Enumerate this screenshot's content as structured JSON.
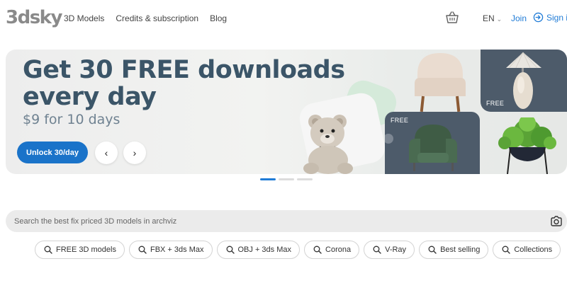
{
  "header": {
    "logo": "3dsky",
    "nav": [
      "3D Models",
      "Credits & subscription",
      "Blog"
    ],
    "lang": "EN",
    "join": "Join",
    "signin": "Sign in"
  },
  "banner": {
    "headline_line1": "Get 30 FREE downloads",
    "headline_line2": "every day",
    "subline": "$9 for 10 days",
    "cta": "Unlock 30/day",
    "free_tag_lamp": "FREE",
    "free_tag_chair": "FREE",
    "prev_icon": "chevron-left-icon",
    "next_icon": "chevron-right-icon",
    "slides_total": 3,
    "active_slide": 1
  },
  "search": {
    "placeholder": "Search the best fix priced 3D models in archviz"
  },
  "chips": [
    "FREE 3D models",
    "FBX + 3ds Max",
    "OBJ + 3ds Max",
    "Corona",
    "V-Ray",
    "Best selling",
    "Collections"
  ],
  "colors": {
    "accent": "#1f7bd6",
    "cta": "#1a73c9",
    "headline": "#3b5568"
  }
}
